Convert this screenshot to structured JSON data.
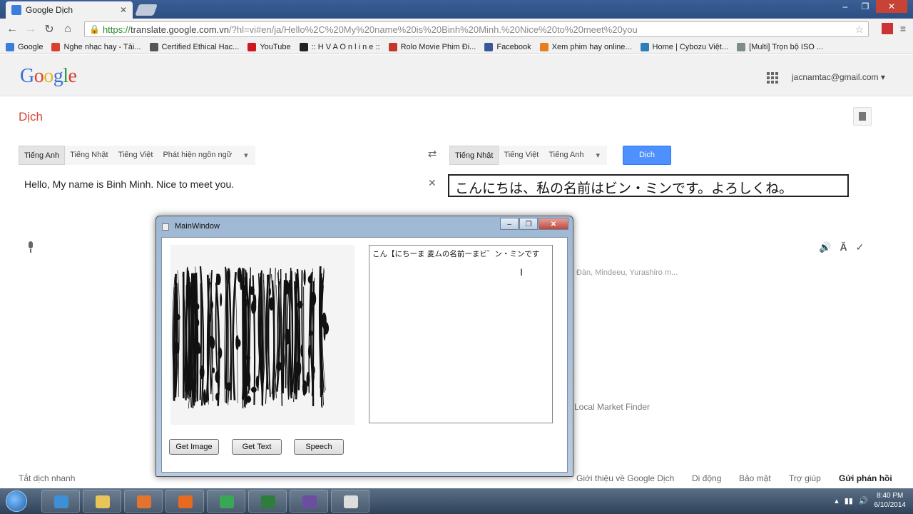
{
  "browser": {
    "tab_title": "Google Dịch",
    "url_https": "https://",
    "url_host": "translate.google.com.vn",
    "url_rest": "/?hl=vi#en/ja/Hello%2C%20My%20name%20is%20Binh%20Minh.%20Nice%20to%20meet%20you",
    "bookmarks": [
      {
        "label": "Google",
        "color": "#3b7ddd"
      },
      {
        "label": "Nghe nhạc hay - Tải...",
        "color": "#d9402f"
      },
      {
        "label": "Certified Ethical Hac...",
        "color": "#555555"
      },
      {
        "label": "YouTube",
        "color": "#cc181e"
      },
      {
        "label": ":: H V A O n l i n e ::",
        "color": "#222222"
      },
      {
        "label": "Rolo Movie Phim Đi...",
        "color": "#c0392b"
      },
      {
        "label": "Facebook",
        "color": "#3b5998"
      },
      {
        "label": "Xem phim hay online...",
        "color": "#e67e22"
      },
      {
        "label": "Home | Cybozu Việt...",
        "color": "#2c7fb8"
      },
      {
        "label": "[Multi] Trọn bộ ISO ...",
        "color": "#7f8c8d"
      }
    ]
  },
  "google": {
    "account": "jacnamtac@gmail.com",
    "page_title": "Dịch",
    "source_langs": [
      "Tiếng Anh",
      "Tiếng Nhật",
      "Tiếng Việt",
      "Phát hiện ngôn ngữ"
    ],
    "target_langs": [
      "Tiếng Nhật",
      "Tiếng Việt",
      "Tiếng Anh"
    ],
    "translate_button": "Dịch",
    "source_text": "Hello, My name is Binh Minh. Nice to meet you.",
    "output_text": "こんにちは、私の名前はビン・ミンです。よろしくね。",
    "bg_text_1": "Đàn, Mindeeu, Yurashiro m...",
    "bg_text_2": "Local Market Finder",
    "footer_left": "Tắt dịch nhanh",
    "footer_links": [
      "Giới thiệu về Google Dịch",
      "Di động",
      "Bảo mật",
      "Trợ giúp",
      "Gửi phản hồi"
    ]
  },
  "mainwindow": {
    "title": "MainWindow",
    "ocr_text": "こん【にちーま 麦ムの名前ーまビ゛ン・ミンです",
    "buttons": {
      "get_image": "Get Image",
      "get_text": "Get Text",
      "speech": "Speech"
    }
  },
  "taskbar": {
    "time": "8:40 PM",
    "date": "6/10/2014",
    "apps": [
      {
        "name": "internet-explorer",
        "color": "#3d8fd6"
      },
      {
        "name": "file-explorer",
        "color": "#e8c559"
      },
      {
        "name": "media-player",
        "color": "#e3742d"
      },
      {
        "name": "firefox",
        "color": "#e66a1f"
      },
      {
        "name": "chrome",
        "color": "#3aa757"
      },
      {
        "name": "console-app",
        "color": "#2f7d3a"
      },
      {
        "name": "visual-studio",
        "color": "#6b4ea0"
      },
      {
        "name": "mainwindow-app",
        "color": "#dddddd"
      }
    ]
  }
}
